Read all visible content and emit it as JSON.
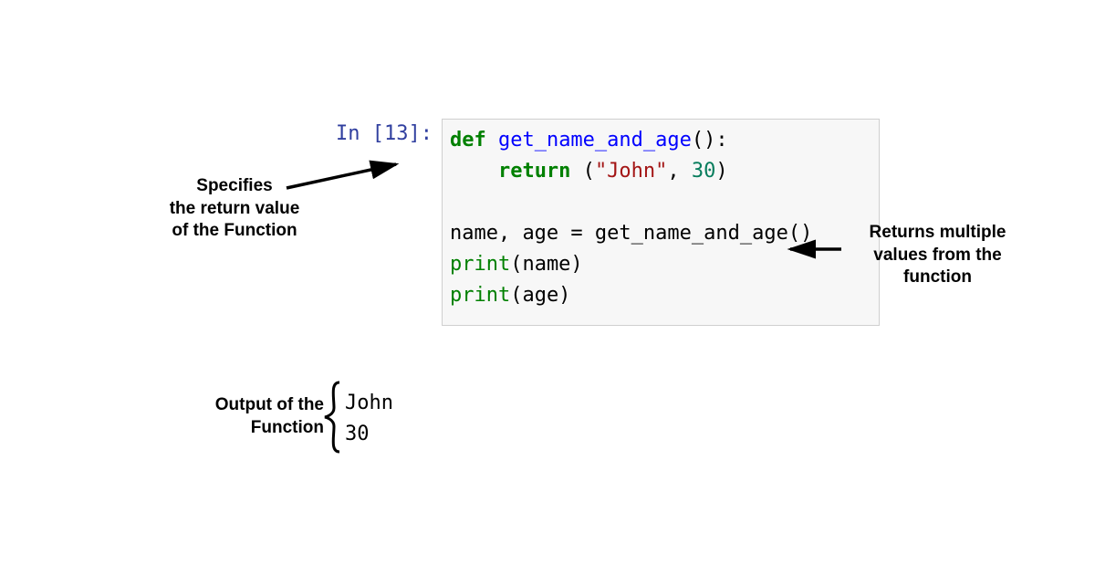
{
  "prompt": "In [13]:",
  "code": {
    "line1": {
      "kw": "def",
      "name": " get_name_and_age",
      "paren": "():"
    },
    "line2": {
      "indent": "    ",
      "kw": "return",
      "open": " (",
      "str": "\"John\"",
      "comma": ", ",
      "num": "30",
      "close": ")"
    },
    "line3": "",
    "line4": {
      "lhs": "name, age = get_name_and_age()"
    },
    "line5": {
      "fn": "print",
      "arg": "(name)"
    },
    "line6": {
      "fn": "print",
      "arg": "(age)"
    }
  },
  "output": {
    "line1": "John",
    "line2": "30"
  },
  "annotations": {
    "left": "Specifies\nthe return value\nof the Function",
    "right": "Returns multiple\nvalues from the\nfunction",
    "output": "Output of the\nFunction"
  }
}
